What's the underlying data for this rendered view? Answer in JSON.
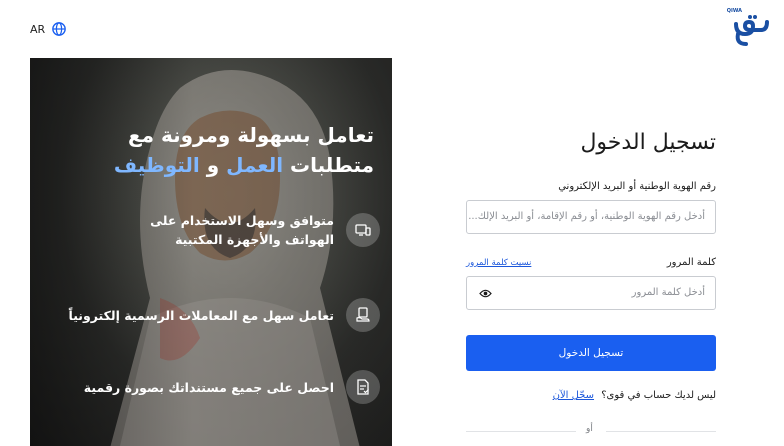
{
  "header": {
    "language_code": "AR",
    "logo_text": "QIWA",
    "icons": {
      "language": "globe-icon",
      "logo": "qiwa-logo"
    }
  },
  "hero": {
    "title_part1": "تعامل بسهولة ومرونة مع متطلبات",
    "title_highlight1": "العمل",
    "title_connector": "و",
    "title_highlight2": "التوظيف",
    "highlight_color": "#7fb7ff",
    "features": [
      {
        "icon": "devices-icon",
        "text": "متوافق وسهل الاستخدام على الهواتف والأجهزة المكتبية"
      },
      {
        "icon": "hand-document-icon",
        "text": "تعامل سهل مع المعاملات الرسمية إلكترونياً"
      },
      {
        "icon": "digital-document-icon",
        "text": "احصل على جميع مستنداتك بصورة رقمية"
      }
    ]
  },
  "login": {
    "title": "تسجيل الدخول",
    "id_label": "رقم الهوية الوطنية أو البريد الإلكتروني",
    "id_placeholder": "أدخل رقم الهوية الوطنية، أو رقم الإقامة، أو البريد الإلك...",
    "password_label": "كلمة المرور",
    "forgot_password": "نسيت كلمة المرور",
    "password_placeholder": "أدخل كلمة المرور",
    "submit_label": "تسجيل الدخول",
    "no_account_text": "ليس لديك حساب في قوى؟",
    "register_link": "سجّل الآن",
    "or_text": "أو",
    "accent_color": "#1a5ff0",
    "link_color": "#1a56db"
  }
}
